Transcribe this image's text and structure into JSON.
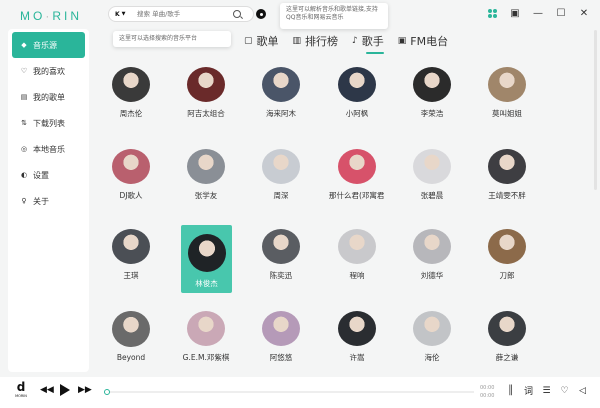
{
  "app": {
    "logo_left": "MO",
    "logo_mid": "·",
    "logo_right": "RIN"
  },
  "search": {
    "source_label": "K",
    "placeholder": "搜索 单曲/歌手"
  },
  "tooltips": {
    "parse": "这里可以解析音乐和歌单链接,支持QQ音乐和网易云音乐",
    "platform": "这里可以选择搜索的音乐平台"
  },
  "sidebar": {
    "items": [
      {
        "label": "音乐源",
        "icon": "compass-icon"
      },
      {
        "label": "我的喜欢",
        "icon": "heart-icon"
      },
      {
        "label": "我的歌单",
        "icon": "playlist-icon"
      },
      {
        "label": "下载列表",
        "icon": "download-icon"
      },
      {
        "label": "本地音乐",
        "icon": "disc-icon"
      },
      {
        "label": "设置",
        "icon": "toggle-icon"
      },
      {
        "label": "关于",
        "icon": "bulb-icon"
      }
    ]
  },
  "tabs": [
    {
      "label": "歌单",
      "icon": "songlist-icon"
    },
    {
      "label": "排行榜",
      "icon": "chart-icon"
    },
    {
      "label": "歌手",
      "icon": "singer-icon",
      "active": true
    },
    {
      "label": "FM电台",
      "icon": "radio-icon"
    }
  ],
  "artists": [
    {
      "name": "周杰伦",
      "color": "#3a3a3a"
    },
    {
      "name": "阿吉太组合",
      "color": "#6a2a2a"
    },
    {
      "name": "海来阿木",
      "color": "#4a5568"
    },
    {
      "name": "小阿枫",
      "color": "#2d3748"
    },
    {
      "name": "李荣浩",
      "color": "#2b2b2b"
    },
    {
      "name": "莫叫姐姐",
      "color": "#a0866a"
    },
    {
      "name": "DJ歌人",
      "color": "#b9606e"
    },
    {
      "name": "张学友",
      "color": "#8a8f96"
    },
    {
      "name": "周深",
      "color": "#c8ccd2"
    },
    {
      "name": "那什么君(邓寓君)",
      "color": "#d7526a"
    },
    {
      "name": "张碧晨",
      "color": "#d9d9dc"
    },
    {
      "name": "王靖雯不胖",
      "color": "#3e3e42"
    },
    {
      "name": "王琪",
      "color": "#4b4f55"
    },
    {
      "name": "林俊杰",
      "color": "#1f2326",
      "selected": true
    },
    {
      "name": "陈奕迅",
      "color": "#5a5d62"
    },
    {
      "name": "程响",
      "color": "#c9c9cc"
    },
    {
      "name": "刘德华",
      "color": "#b7b7bb"
    },
    {
      "name": "刀郎",
      "color": "#8c6a4a"
    },
    {
      "name": "Beyond",
      "color": "#6a6a6a"
    },
    {
      "name": "G.E.M.邓紫棋",
      "color": "#caa8b6"
    },
    {
      "name": "阿悠悠",
      "color": "#b59ab8"
    },
    {
      "name": "许嵩",
      "color": "#2a2d31"
    },
    {
      "name": "海伦",
      "color": "#c2c4c7"
    },
    {
      "name": "薛之谦",
      "color": "#3b3e42"
    }
  ],
  "player": {
    "logo_text": "d",
    "logo_sub": "MORIN",
    "time_current": "00:00",
    "time_total": "00:00",
    "progress": 0
  },
  "colors": {
    "accent": "#2ab59a",
    "selected_card": "#48c7ad"
  }
}
